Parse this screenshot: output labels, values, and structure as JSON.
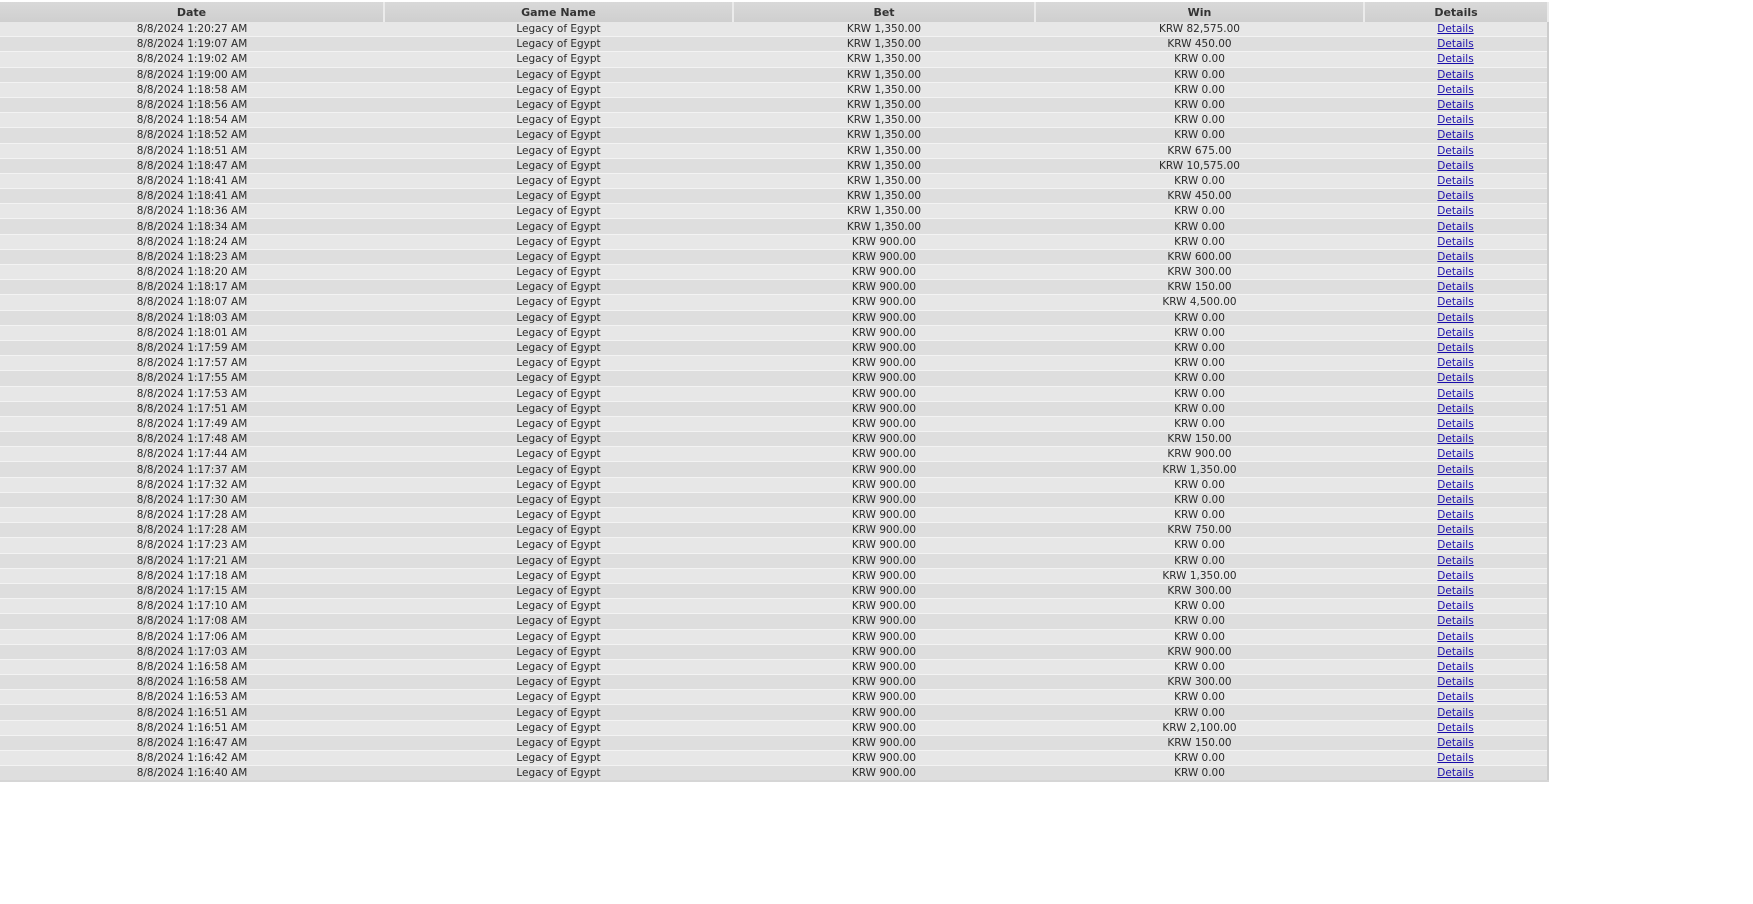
{
  "table": {
    "columns": [
      "Date",
      "Game Name",
      "Bet",
      "Win",
      "Details"
    ],
    "rows": [
      {
        "date": "8/8/2024 1:20:27 AM",
        "game": "Legacy of Egypt",
        "bet": "KRW 1,350.00",
        "win": "KRW 82,575.00",
        "details": "Details"
      },
      {
        "date": "8/8/2024 1:19:07 AM",
        "game": "Legacy of Egypt",
        "bet": "KRW 1,350.00",
        "win": "KRW 450.00",
        "details": "Details"
      },
      {
        "date": "8/8/2024 1:19:02 AM",
        "game": "Legacy of Egypt",
        "bet": "KRW 1,350.00",
        "win": "KRW 0.00",
        "details": "Details"
      },
      {
        "date": "8/8/2024 1:19:00 AM",
        "game": "Legacy of Egypt",
        "bet": "KRW 1,350.00",
        "win": "KRW 0.00",
        "details": "Details"
      },
      {
        "date": "8/8/2024 1:18:58 AM",
        "game": "Legacy of Egypt",
        "bet": "KRW 1,350.00",
        "win": "KRW 0.00",
        "details": "Details"
      },
      {
        "date": "8/8/2024 1:18:56 AM",
        "game": "Legacy of Egypt",
        "bet": "KRW 1,350.00",
        "win": "KRW 0.00",
        "details": "Details"
      },
      {
        "date": "8/8/2024 1:18:54 AM",
        "game": "Legacy of Egypt",
        "bet": "KRW 1,350.00",
        "win": "KRW 0.00",
        "details": "Details"
      },
      {
        "date": "8/8/2024 1:18:52 AM",
        "game": "Legacy of Egypt",
        "bet": "KRW 1,350.00",
        "win": "KRW 0.00",
        "details": "Details"
      },
      {
        "date": "8/8/2024 1:18:51 AM",
        "game": "Legacy of Egypt",
        "bet": "KRW 1,350.00",
        "win": "KRW 675.00",
        "details": "Details"
      },
      {
        "date": "8/8/2024 1:18:47 AM",
        "game": "Legacy of Egypt",
        "bet": "KRW 1,350.00",
        "win": "KRW 10,575.00",
        "details": "Details"
      },
      {
        "date": "8/8/2024 1:18:41 AM",
        "game": "Legacy of Egypt",
        "bet": "KRW 1,350.00",
        "win": "KRW 0.00",
        "details": "Details"
      },
      {
        "date": "8/8/2024 1:18:41 AM",
        "game": "Legacy of Egypt",
        "bet": "KRW 1,350.00",
        "win": "KRW 450.00",
        "details": "Details"
      },
      {
        "date": "8/8/2024 1:18:36 AM",
        "game": "Legacy of Egypt",
        "bet": "KRW 1,350.00",
        "win": "KRW 0.00",
        "details": "Details"
      },
      {
        "date": "8/8/2024 1:18:34 AM",
        "game": "Legacy of Egypt",
        "bet": "KRW 1,350.00",
        "win": "KRW 0.00",
        "details": "Details"
      },
      {
        "date": "8/8/2024 1:18:24 AM",
        "game": "Legacy of Egypt",
        "bet": "KRW 900.00",
        "win": "KRW 0.00",
        "details": "Details"
      },
      {
        "date": "8/8/2024 1:18:23 AM",
        "game": "Legacy of Egypt",
        "bet": "KRW 900.00",
        "win": "KRW 600.00",
        "details": "Details"
      },
      {
        "date": "8/8/2024 1:18:20 AM",
        "game": "Legacy of Egypt",
        "bet": "KRW 900.00",
        "win": "KRW 300.00",
        "details": "Details"
      },
      {
        "date": "8/8/2024 1:18:17 AM",
        "game": "Legacy of Egypt",
        "bet": "KRW 900.00",
        "win": "KRW 150.00",
        "details": "Details"
      },
      {
        "date": "8/8/2024 1:18:07 AM",
        "game": "Legacy of Egypt",
        "bet": "KRW 900.00",
        "win": "KRW 4,500.00",
        "details": "Details"
      },
      {
        "date": "8/8/2024 1:18:03 AM",
        "game": "Legacy of Egypt",
        "bet": "KRW 900.00",
        "win": "KRW 0.00",
        "details": "Details"
      },
      {
        "date": "8/8/2024 1:18:01 AM",
        "game": "Legacy of Egypt",
        "bet": "KRW 900.00",
        "win": "KRW 0.00",
        "details": "Details"
      },
      {
        "date": "8/8/2024 1:17:59 AM",
        "game": "Legacy of Egypt",
        "bet": "KRW 900.00",
        "win": "KRW 0.00",
        "details": "Details"
      },
      {
        "date": "8/8/2024 1:17:57 AM",
        "game": "Legacy of Egypt",
        "bet": "KRW 900.00",
        "win": "KRW 0.00",
        "details": "Details"
      },
      {
        "date": "8/8/2024 1:17:55 AM",
        "game": "Legacy of Egypt",
        "bet": "KRW 900.00",
        "win": "KRW 0.00",
        "details": "Details"
      },
      {
        "date": "8/8/2024 1:17:53 AM",
        "game": "Legacy of Egypt",
        "bet": "KRW 900.00",
        "win": "KRW 0.00",
        "details": "Details"
      },
      {
        "date": "8/8/2024 1:17:51 AM",
        "game": "Legacy of Egypt",
        "bet": "KRW 900.00",
        "win": "KRW 0.00",
        "details": "Details"
      },
      {
        "date": "8/8/2024 1:17:49 AM",
        "game": "Legacy of Egypt",
        "bet": "KRW 900.00",
        "win": "KRW 0.00",
        "details": "Details"
      },
      {
        "date": "8/8/2024 1:17:48 AM",
        "game": "Legacy of Egypt",
        "bet": "KRW 900.00",
        "win": "KRW 150.00",
        "details": "Details"
      },
      {
        "date": "8/8/2024 1:17:44 AM",
        "game": "Legacy of Egypt",
        "bet": "KRW 900.00",
        "win": "KRW 900.00",
        "details": "Details"
      },
      {
        "date": "8/8/2024 1:17:37 AM",
        "game": "Legacy of Egypt",
        "bet": "KRW 900.00",
        "win": "KRW 1,350.00",
        "details": "Details"
      },
      {
        "date": "8/8/2024 1:17:32 AM",
        "game": "Legacy of Egypt",
        "bet": "KRW 900.00",
        "win": "KRW 0.00",
        "details": "Details"
      },
      {
        "date": "8/8/2024 1:17:30 AM",
        "game": "Legacy of Egypt",
        "bet": "KRW 900.00",
        "win": "KRW 0.00",
        "details": "Details"
      },
      {
        "date": "8/8/2024 1:17:28 AM",
        "game": "Legacy of Egypt",
        "bet": "KRW 900.00",
        "win": "KRW 0.00",
        "details": "Details"
      },
      {
        "date": "8/8/2024 1:17:28 AM",
        "game": "Legacy of Egypt",
        "bet": "KRW 900.00",
        "win": "KRW 750.00",
        "details": "Details"
      },
      {
        "date": "8/8/2024 1:17:23 AM",
        "game": "Legacy of Egypt",
        "bet": "KRW 900.00",
        "win": "KRW 0.00",
        "details": "Details"
      },
      {
        "date": "8/8/2024 1:17:21 AM",
        "game": "Legacy of Egypt",
        "bet": "KRW 900.00",
        "win": "KRW 0.00",
        "details": "Details"
      },
      {
        "date": "8/8/2024 1:17:18 AM",
        "game": "Legacy of Egypt",
        "bet": "KRW 900.00",
        "win": "KRW 1,350.00",
        "details": "Details"
      },
      {
        "date": "8/8/2024 1:17:15 AM",
        "game": "Legacy of Egypt",
        "bet": "KRW 900.00",
        "win": "KRW 300.00",
        "details": "Details"
      },
      {
        "date": "8/8/2024 1:17:10 AM",
        "game": "Legacy of Egypt",
        "bet": "KRW 900.00",
        "win": "KRW 0.00",
        "details": "Details"
      },
      {
        "date": "8/8/2024 1:17:08 AM",
        "game": "Legacy of Egypt",
        "bet": "KRW 900.00",
        "win": "KRW 0.00",
        "details": "Details"
      },
      {
        "date": "8/8/2024 1:17:06 AM",
        "game": "Legacy of Egypt",
        "bet": "KRW 900.00",
        "win": "KRW 0.00",
        "details": "Details"
      },
      {
        "date": "8/8/2024 1:17:03 AM",
        "game": "Legacy of Egypt",
        "bet": "KRW 900.00",
        "win": "KRW 900.00",
        "details": "Details"
      },
      {
        "date": "8/8/2024 1:16:58 AM",
        "game": "Legacy of Egypt",
        "bet": "KRW 900.00",
        "win": "KRW 0.00",
        "details": "Details"
      },
      {
        "date": "8/8/2024 1:16:58 AM",
        "game": "Legacy of Egypt",
        "bet": "KRW 900.00",
        "win": "KRW 300.00",
        "details": "Details"
      },
      {
        "date": "8/8/2024 1:16:53 AM",
        "game": "Legacy of Egypt",
        "bet": "KRW 900.00",
        "win": "KRW 0.00",
        "details": "Details"
      },
      {
        "date": "8/8/2024 1:16:51 AM",
        "game": "Legacy of Egypt",
        "bet": "KRW 900.00",
        "win": "KRW 0.00",
        "details": "Details"
      },
      {
        "date": "8/8/2024 1:16:51 AM",
        "game": "Legacy of Egypt",
        "bet": "KRW 900.00",
        "win": "KRW 2,100.00",
        "details": "Details"
      },
      {
        "date": "8/8/2024 1:16:47 AM",
        "game": "Legacy of Egypt",
        "bet": "KRW 900.00",
        "win": "KRW 150.00",
        "details": "Details"
      },
      {
        "date": "8/8/2024 1:16:42 AM",
        "game": "Legacy of Egypt",
        "bet": "KRW 900.00",
        "win": "KRW 0.00",
        "details": "Details"
      },
      {
        "date": "8/8/2024 1:16:40 AM",
        "game": "Legacy of Egypt",
        "bet": "KRW 900.00",
        "win": "KRW 0.00",
        "details": "Details"
      }
    ]
  },
  "colors": {
    "header_bg": "#d3d3d3",
    "row_odd_bg": "#e7e7e7",
    "row_even_bg": "#dedede",
    "link": "#1a0dab"
  }
}
